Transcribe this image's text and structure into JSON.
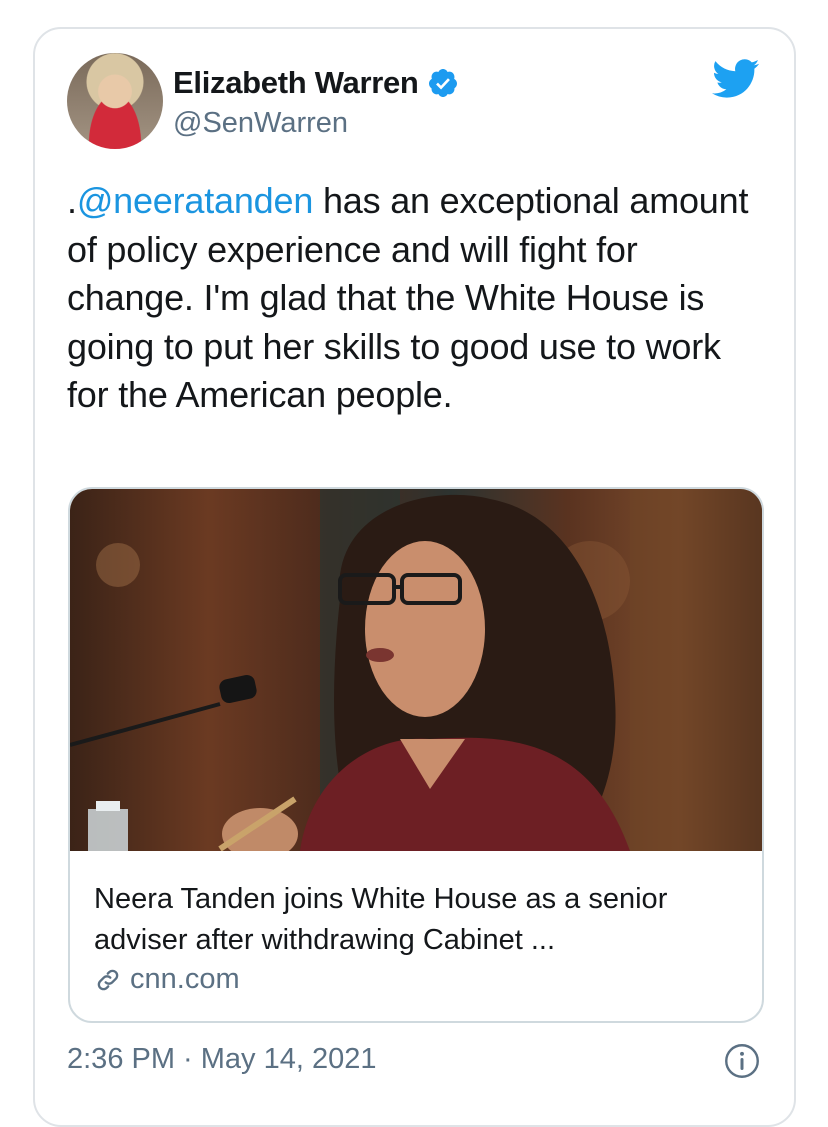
{
  "tweet": {
    "author": {
      "display_name": "Elizabeth Warren",
      "handle": "@SenWarren",
      "verified_icon": "verified-badge-icon",
      "avatar": "avatar-photo"
    },
    "text": {
      "prefix": ".",
      "mention": "@neeratanden",
      "body": " has an exceptional amount of policy experience and will fight for change. I'm glad that the White House is going to put her skills to good use to work for the American people."
    },
    "link_card": {
      "title": "Neera Tanden joins White House as a senior adviser after withdrawing Cabinet ...",
      "domain": "cnn.com",
      "domain_icon": "link-icon"
    },
    "timestamp": "2:36 PM · May 14, 2021",
    "brand_icon": "twitter-bird-icon",
    "info_icon": "info-icon"
  },
  "colors": {
    "accent": "#1b95e0",
    "secondary_text": "#5b7083",
    "border": "#cfd9de"
  }
}
